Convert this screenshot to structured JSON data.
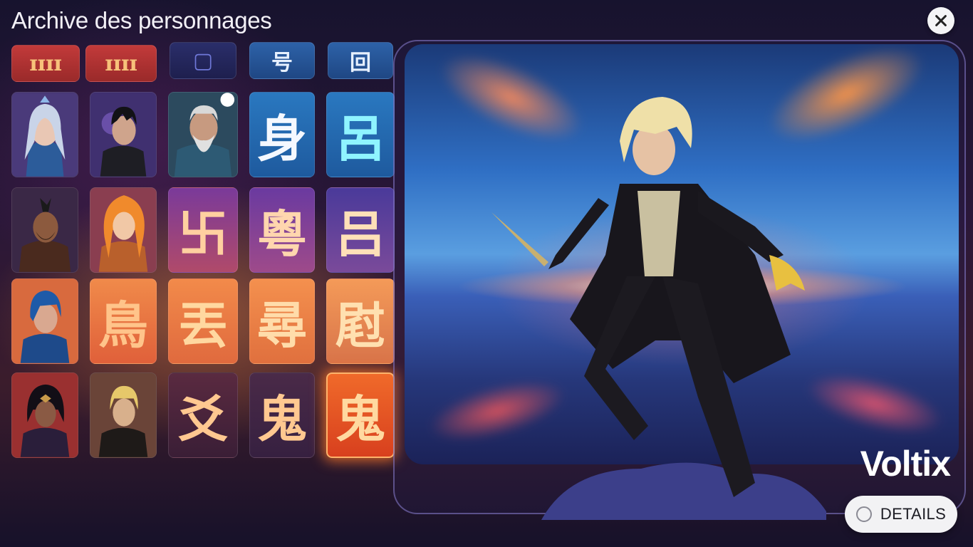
{
  "header": {
    "title": "Archive des personnages"
  },
  "selected_character": {
    "name": "Voltix",
    "details_label": "DETAILS"
  },
  "icons": {
    "close": "close-icon",
    "details": "radio-ring-icon"
  },
  "grid": {
    "top_row": [
      "ɪɪɪɪ",
      "ɪɪɪɪ",
      "▢",
      "号",
      "回"
    ],
    "rows": [
      [
        "portrait",
        "portrait",
        "portrait",
        "身",
        "呂"
      ],
      [
        "portrait",
        "portrait",
        "卐",
        "粵",
        "吕"
      ],
      [
        "portrait",
        "鳥",
        "丟",
        "尋",
        "屗"
      ],
      [
        "portrait",
        "portrait",
        "爻",
        "鬼",
        "鬼"
      ]
    ],
    "selected_index": [
      3,
      4
    ]
  },
  "colors": {
    "accent": "#ff8a3d",
    "frame": "#8c82d2",
    "button_bg": "#f2f2f4"
  }
}
